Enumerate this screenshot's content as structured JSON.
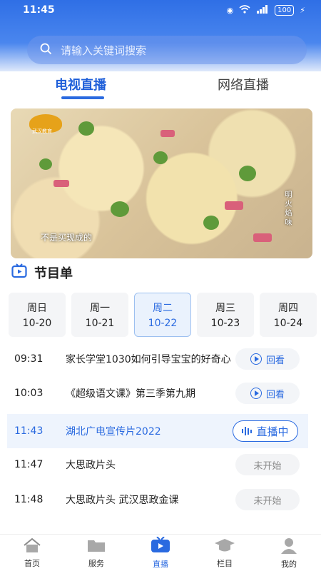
{
  "status_bar": {
    "time": "11:45",
    "battery": "100"
  },
  "search": {
    "placeholder": "请输入关键词搜索"
  },
  "tabs": [
    {
      "label": "电视直播",
      "active": true
    },
    {
      "label": "网络直播",
      "active": false
    }
  ],
  "video": {
    "logo_text": "武汉教育",
    "subtitle": "不是买现成的",
    "vertical_text": "明火焰味"
  },
  "schedule": {
    "title": "节目单",
    "days": [
      {
        "day": "周日",
        "date": "10-20",
        "active": false
      },
      {
        "day": "周一",
        "date": "10-21",
        "active": false
      },
      {
        "day": "周二",
        "date": "10-22",
        "active": true
      },
      {
        "day": "周三",
        "date": "10-23",
        "active": false
      },
      {
        "day": "周四",
        "date": "10-24",
        "active": false
      }
    ],
    "programs": [
      {
        "time": "09:31",
        "title": "家长学堂1030如何引导宝宝的好奇心",
        "action": "回看",
        "state": "replay"
      },
      {
        "time": "10:03",
        "title": "《超级语文课》第三季第九期",
        "action": "回看",
        "state": "replay"
      },
      {
        "time": "11:43",
        "title": "湖北广电宣传片2022",
        "action": "直播中",
        "state": "live"
      },
      {
        "time": "11:47",
        "title": "大思政片头",
        "action": "未开始",
        "state": "wait"
      },
      {
        "time": "11:48",
        "title": "大思政片头 武汉思政金课",
        "action": "未开始",
        "state": "wait"
      }
    ]
  },
  "nav": [
    {
      "label": "首页",
      "icon": "home-icon",
      "active": false
    },
    {
      "label": "服务",
      "icon": "service-icon",
      "active": false
    },
    {
      "label": "直播",
      "icon": "tv-icon",
      "active": true
    },
    {
      "label": "栏目",
      "icon": "column-icon",
      "active": false
    },
    {
      "label": "我的",
      "icon": "user-icon",
      "active": false
    }
  ],
  "colors": {
    "accent": "#2a6ae0",
    "header": "#2f6fe6"
  }
}
